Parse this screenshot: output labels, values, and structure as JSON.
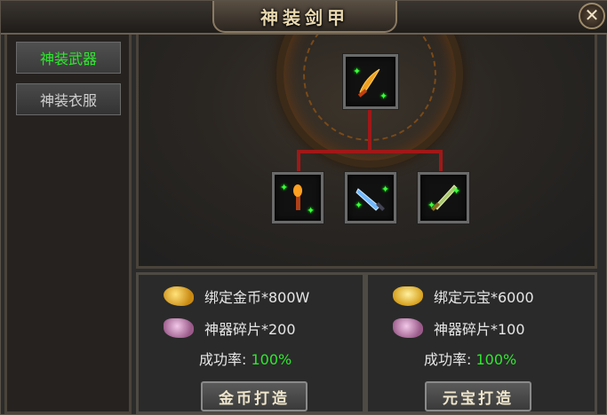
{
  "window": {
    "title": "神装剑甲",
    "close_glyph": "✕"
  },
  "sidebar": {
    "tabs": [
      {
        "label": "神装武器",
        "active": true
      },
      {
        "label": "神装衣服",
        "active": false
      }
    ]
  },
  "crafting": {
    "target_item": "sword-icon",
    "materials": [
      "torch-icon",
      "blue-blade-icon",
      "green-blade-icon"
    ]
  },
  "recipes": [
    {
      "currency": {
        "icon": "gold-coins-icon",
        "text": "绑定金币*800W"
      },
      "material": {
        "icon": "artifact-shard-icon",
        "text": "神器碎片*200"
      },
      "rate_label": "成功率:",
      "rate_value": "100%",
      "button_label": "金币打造"
    },
    {
      "currency": {
        "icon": "gold-ingot-icon",
        "text": "绑定元宝*6000"
      },
      "material": {
        "icon": "artifact-shard-icon",
        "text": "神器碎片*100"
      },
      "rate_label": "成功率:",
      "rate_value": "100%",
      "button_label": "元宝打造"
    }
  ],
  "colors": {
    "active_tab": "#2ee82e",
    "success_rate": "#2ee82e",
    "connector": "#a01818"
  }
}
